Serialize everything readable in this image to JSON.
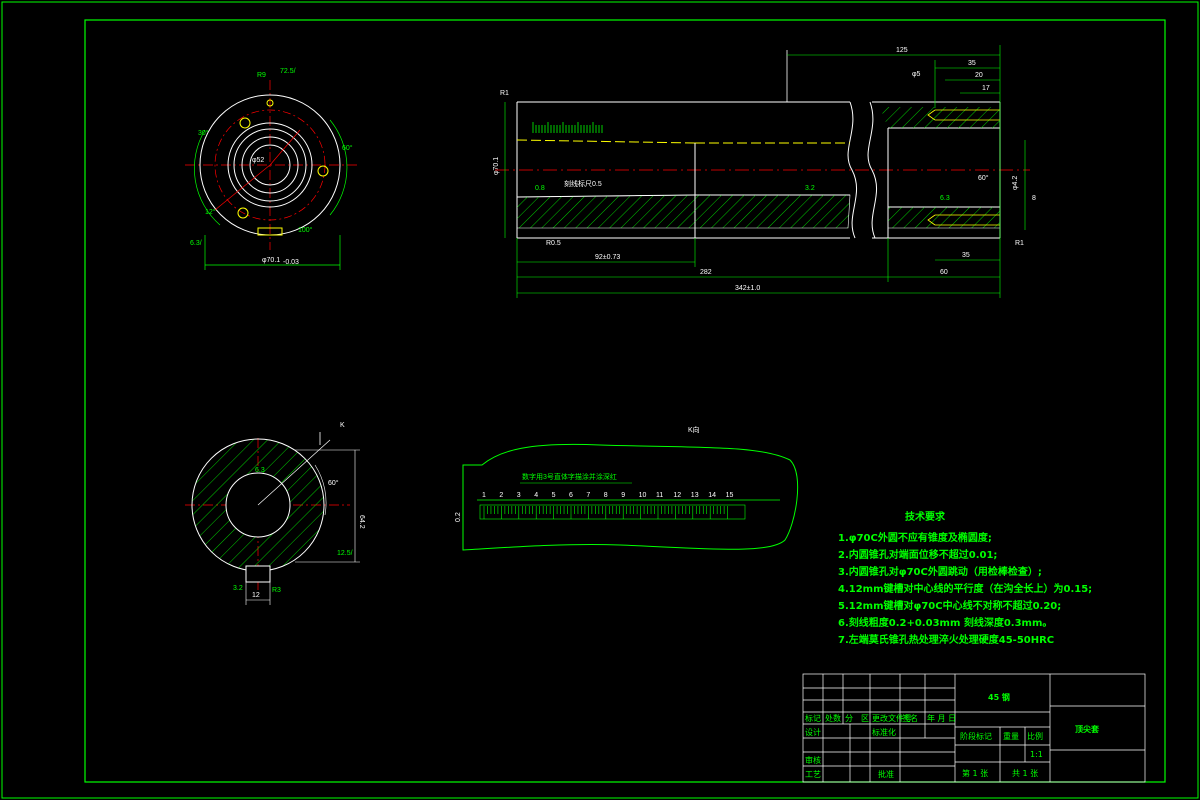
{
  "drawing": {
    "frame_color": "#00ff00",
    "dim_color": "#ffffff",
    "center_color": "#ff0000",
    "part_color": "#ffff00"
  },
  "front_view": {
    "labels": {
      "r9": "R9",
      "ra": "72.5/",
      "d_inner": "φ52",
      "d_outer": "φ70.1",
      "d_outer_tol": "-0.03",
      "ang1": "30°",
      "ang2": "60°",
      "r_lbl": "100°",
      "r_lbl2": "12°",
      "ra2": "6.3/"
    }
  },
  "main_view": {
    "dims": {
      "d125": "125",
      "d35a": "35",
      "d20": "20",
      "d17": "17",
      "d5": "φ5",
      "d92": "92±0.73",
      "d282": "282",
      "d342": "342±1.0",
      "d35b": "35",
      "d60": "60",
      "r1": "R1",
      "r1b": "R1",
      "r05": "R0.5",
      "dia": "φ70.1",
      "angle": "60°",
      "ra08": "0.8",
      "ra32": "3.2",
      "ra63": "6.3",
      "note": "刻线标尺0.5",
      "d42": "φ4.2",
      "d8": "8"
    }
  },
  "section_k": {
    "title": "K",
    "dims": {
      "h": "64.2",
      "w": "12",
      "r": "R3",
      "ang": "60°",
      "ra": "12.5/",
      "ra2": "3.2",
      "ra3": "6.3"
    }
  },
  "k_view": {
    "title": "K向",
    "note": "数字用3号直体字描涂并涂深红",
    "scale_numbers": [
      "1",
      "2",
      "3",
      "4",
      "5",
      "6",
      "7",
      "8",
      "9",
      "10",
      "11",
      "12",
      "13",
      "14",
      "15"
    ],
    "side_dim": "0.2"
  },
  "requirements": {
    "title": "技术要求",
    "items": [
      "1.φ70C外圆不应有锥度及椭圆度;",
      "2.内圆锥孔对端面位移不超过0.01;",
      "3.内圆锥孔对φ70C外圆跳动（用检棒检查）;",
      "4.12mm键槽对中心线的平行度（在沟全长上）为0.15;",
      "5.12mm键槽对φ70C中心线不对称不超过0.20;",
      "6.刻线粗度0.2+0.03mm 刻线深度0.3mm。",
      "7.左端莫氏锥孔热处理淬火处理硬度45-50HRC"
    ]
  },
  "title_block": {
    "material": "45 钢",
    "part_name": "顶尖套",
    "h_mark": "标记",
    "h_count": "处数",
    "h_zone": "分　区",
    "h_docno": "更改文件号",
    "h_sign": "签名",
    "h_date": "年 月 日",
    "designer": "设计",
    "standardize": "标准化",
    "stage": "阶段标记",
    "weight": "重量",
    "scale": "比例",
    "scale_val": "1:1",
    "review": "审核",
    "process": "工艺",
    "approve": "批准",
    "sheet": "第 1 张",
    "sheets": "共 1 张"
  }
}
